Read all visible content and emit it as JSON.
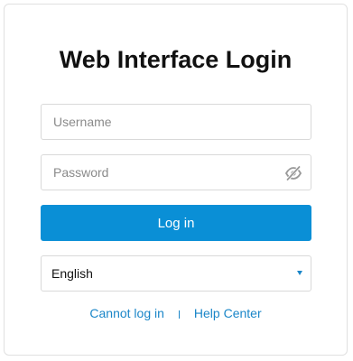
{
  "login": {
    "title": "Web Interface Login",
    "username_placeholder": "Username",
    "username_value": "",
    "password_placeholder": "Password",
    "password_value": "",
    "password_toggle_icon": "eye-slash-icon",
    "login_label": "Log in",
    "language": {
      "selected": "English",
      "dropdown_icon": "caret-down-icon"
    },
    "links": {
      "cannot_login": "Cannot log in",
      "help_center": "Help Center"
    }
  },
  "colors": {
    "accent": "#0a8fd6",
    "link": "#1a86c8",
    "border": "#d9d9d9",
    "title": "#111111",
    "placeholder": "#8a8a8a"
  }
}
